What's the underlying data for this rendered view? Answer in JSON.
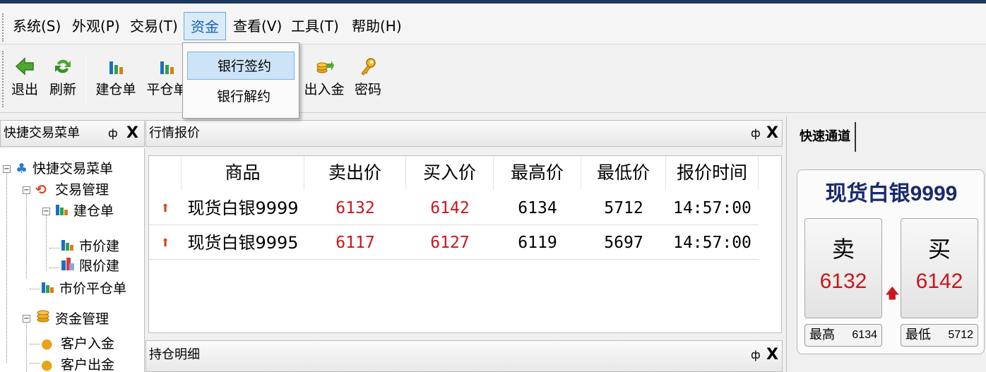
{
  "menu": {
    "items": [
      "系统(S)",
      "外观(P)",
      "交易(T)",
      "资金",
      "查看(V)",
      "工具(T)",
      "帮助(H)"
    ],
    "active_index": 3
  },
  "toolbar": {
    "buttons": [
      "退出",
      "刷新",
      "建仓单",
      "平仓单",
      "出入金",
      "密码"
    ]
  },
  "funds_menu": {
    "items": [
      "银行签约",
      "银行解约"
    ],
    "highlighted_index": 0
  },
  "left_panel": {
    "title": "快捷交易菜单",
    "tree": [
      "快捷交易菜单",
      "交易管理",
      "建仓单",
      "市价建",
      "限价建",
      "市价平仓单",
      "资金管理",
      "客户入金",
      "客户出金"
    ]
  },
  "quote_panel": {
    "title": "行情报价",
    "columns": [
      "商品",
      "卖出价",
      "买入价",
      "最高价",
      "最低价",
      "报价时间"
    ],
    "rows": [
      {
        "name": "现货白银9999",
        "sell": "6132",
        "buy": "6142",
        "high": "6134",
        "low": "5712",
        "time": "14:57:00"
      },
      {
        "name": "现货白银9995",
        "sell": "6117",
        "buy": "6127",
        "high": "6119",
        "low": "5697",
        "time": "14:57:00"
      }
    ],
    "trend": "up"
  },
  "position_panel": {
    "title": "持仓明细"
  },
  "quick_channel": {
    "tab": "快速通道",
    "product": "现货白银9999",
    "sell_label": "卖",
    "sell_price": "6132",
    "buy_label": "买",
    "buy_price": "6142",
    "high_label": "最高",
    "high_value": "6134",
    "low_label": "最低",
    "low_value": "5712"
  },
  "pane_controls": {
    "pin": "ф",
    "close": "X"
  },
  "colors": {
    "price_red": "#c8161d",
    "accent_blue": "#1560b0",
    "title_navy": "#1a2a6c"
  }
}
